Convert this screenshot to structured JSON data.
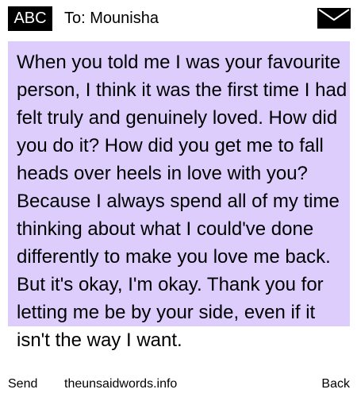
{
  "header": {
    "badge": "ABC",
    "recipient": "To: Mounisha",
    "icon": "envelope-icon"
  },
  "message": {
    "text": "When you told me I was your favourite person, I think it was the first time I had felt truly and genuinely loved. How did you do it? How did you get me to fall heads over heels in love with you? Because I always spend all of my time thinking about what I could've done differently to make you love me back. But it's okay, I'm okay. Thank you for letting me be by your side, even if it isn't the way I want.",
    "background_color": "#dccdfd"
  },
  "footer": {
    "send_label": "Send",
    "site_label": "theunsaidwords.info",
    "back_label": "Back"
  }
}
